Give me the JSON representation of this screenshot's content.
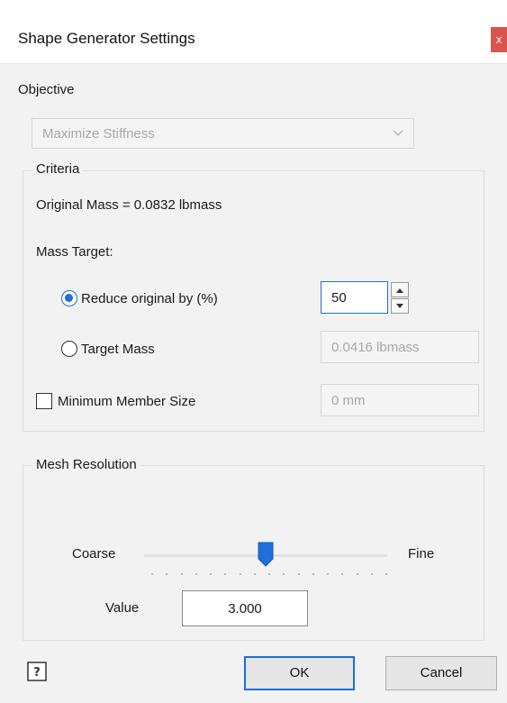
{
  "window": {
    "title": "Shape Generator Settings",
    "close_label": "x"
  },
  "objective": {
    "label": "Objective",
    "selected_value": "Maximize Stiffness"
  },
  "criteria": {
    "legend": "Criteria",
    "original_mass_text": "Original Mass = 0.0832 lbmass",
    "mass_target_label": "Mass Target:",
    "reduce_option": {
      "label": "Reduce original by (%)",
      "checked": true,
      "value": "50"
    },
    "target_mass_option": {
      "label": "Target Mass",
      "checked": false,
      "value": "0.0416 lbmass"
    },
    "minimum_member": {
      "label": "Minimum Member Size",
      "checked": false,
      "value": "0 mm"
    }
  },
  "mesh": {
    "legend": "Mesh Resolution",
    "min_label": "Coarse",
    "max_label": "Fine",
    "slider_position": 0.5,
    "value_label": "Value",
    "value": "3.000"
  },
  "buttons": {
    "ok": "OK",
    "cancel": "Cancel"
  },
  "icons": {
    "help": "help-icon",
    "close": "close-icon",
    "dropdown": "chevron-down-icon"
  },
  "colors": {
    "accent": "#1e6fd9",
    "close": "#d9534f"
  }
}
